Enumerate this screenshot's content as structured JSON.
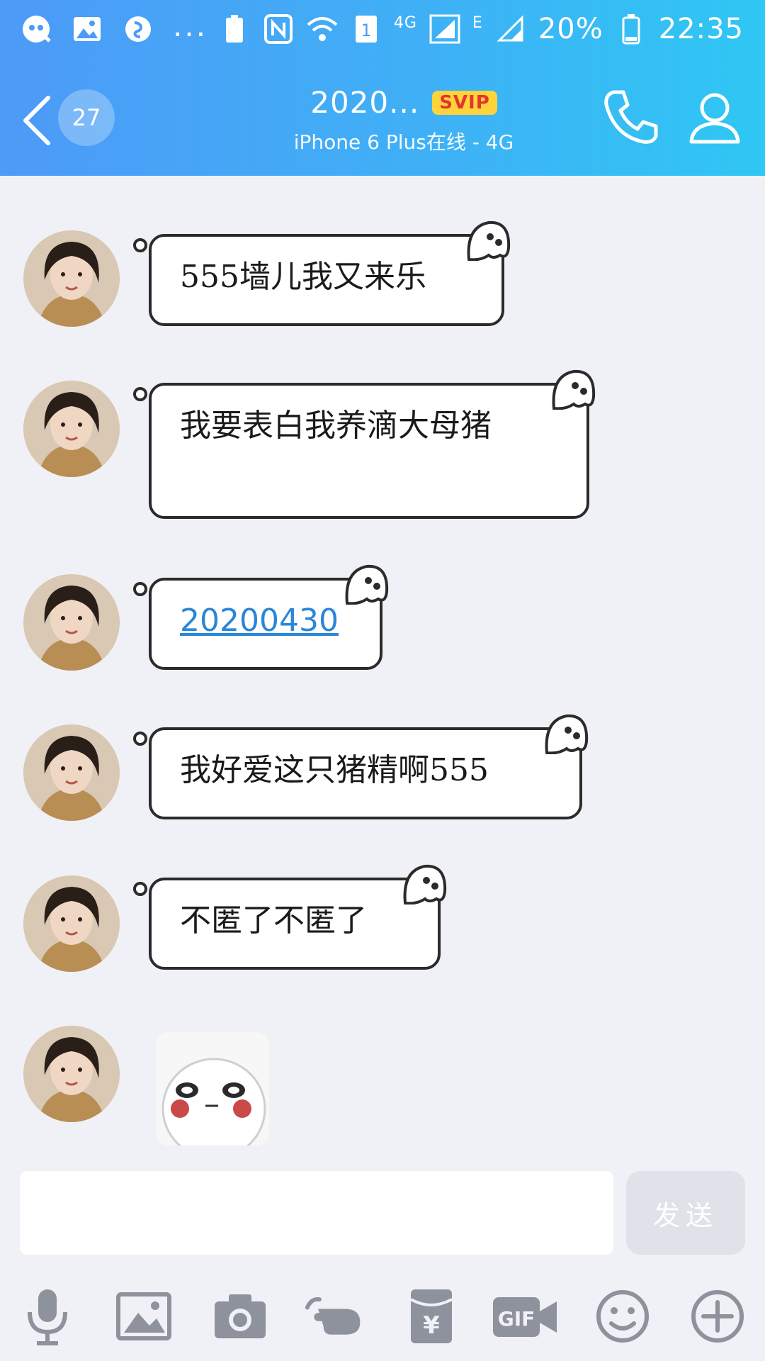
{
  "status_bar": {
    "battery_percent": "20%",
    "time": "22:35",
    "network_4g": "4G",
    "network_e": "E",
    "sim_slot": "1",
    "dots": "..."
  },
  "header": {
    "unread_count": "27",
    "title": "2020...",
    "badge": "SVIP",
    "subtitle": "iPhone 6 Plus在线 - 4G"
  },
  "messages": [
    {
      "text": "555墙儿我又来乐"
    },
    {
      "text": "我要表白我养滴大母猪"
    },
    {
      "text": "20200430",
      "is_link": true
    },
    {
      "text": "我好爱这只猪精啊555"
    },
    {
      "text": "不匿了不匿了"
    },
    {
      "sticker": true
    }
  ],
  "composer": {
    "placeholder": "",
    "send_label": "发送"
  },
  "toolbar": {
    "gif_label": "GIF",
    "redpacket_symbol": "¥"
  },
  "colors": {
    "header_start": "#4d9af7",
    "header_end": "#2fc7f3",
    "link": "#2b86d7",
    "svip_bg": "#ffd43a",
    "svip_text": "#e2362f"
  }
}
